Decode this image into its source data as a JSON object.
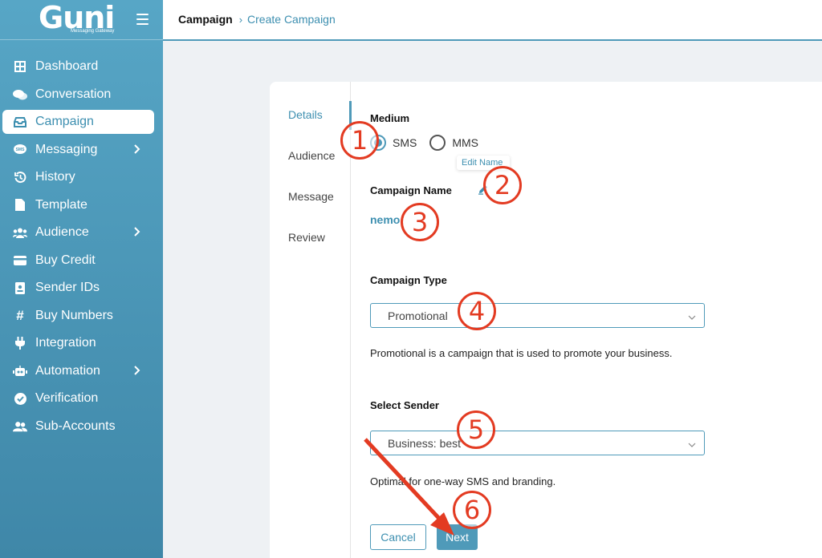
{
  "logo": {
    "text": "Guni",
    "subtitle": "Messaging Gateway"
  },
  "header": {
    "breadcrumb_root": "Campaign",
    "breadcrumb_sep": "›",
    "breadcrumb_current": "Create Campaign"
  },
  "sidebar": {
    "items": [
      {
        "label": "Dashboard",
        "icon": "dashboard-icon"
      },
      {
        "label": "Conversation",
        "icon": "chat-icon"
      },
      {
        "label": "Campaign",
        "icon": "inbox-icon",
        "active": true
      },
      {
        "label": "Messaging",
        "icon": "sms-icon",
        "has_submenu": true
      },
      {
        "label": "History",
        "icon": "history-icon"
      },
      {
        "label": "Template",
        "icon": "file-icon"
      },
      {
        "label": "Audience",
        "icon": "users-icon",
        "has_submenu": true
      },
      {
        "label": "Buy Credit",
        "icon": "credit-card-icon"
      },
      {
        "label": "Sender IDs",
        "icon": "id-badge-icon"
      },
      {
        "label": "Buy Numbers",
        "icon": "hashtag-icon"
      },
      {
        "label": "Integration",
        "icon": "plug-icon"
      },
      {
        "label": "Automation",
        "icon": "robot-icon",
        "has_submenu": true
      },
      {
        "label": "Verification",
        "icon": "check-circle-icon"
      },
      {
        "label": "Sub-Accounts",
        "icon": "user-group-icon"
      }
    ]
  },
  "steps": [
    "Details",
    "Audience",
    "Message",
    "Review"
  ],
  "form": {
    "medium_label": "Medium",
    "medium_options": [
      "SMS",
      "MMS"
    ],
    "medium_selected": "SMS",
    "tooltip": "Edit Name",
    "campaign_name_label": "Campaign Name",
    "campaign_name_value": "nemo",
    "campaign_type_label": "Campaign Type",
    "campaign_type_value": "Promotional",
    "campaign_type_help": "Promotional is a campaign that is used to promote your business.",
    "sender_label": "Select Sender",
    "sender_value": "Business: best",
    "sender_help": "Optimal for one-way SMS and branding.",
    "cancel_label": "Cancel",
    "next_label": "Next"
  },
  "annotations": [
    "1",
    "2",
    "3",
    "4",
    "5",
    "6"
  ],
  "colors": {
    "accent": "#4f9ab9",
    "annotation": "#e33b22"
  }
}
